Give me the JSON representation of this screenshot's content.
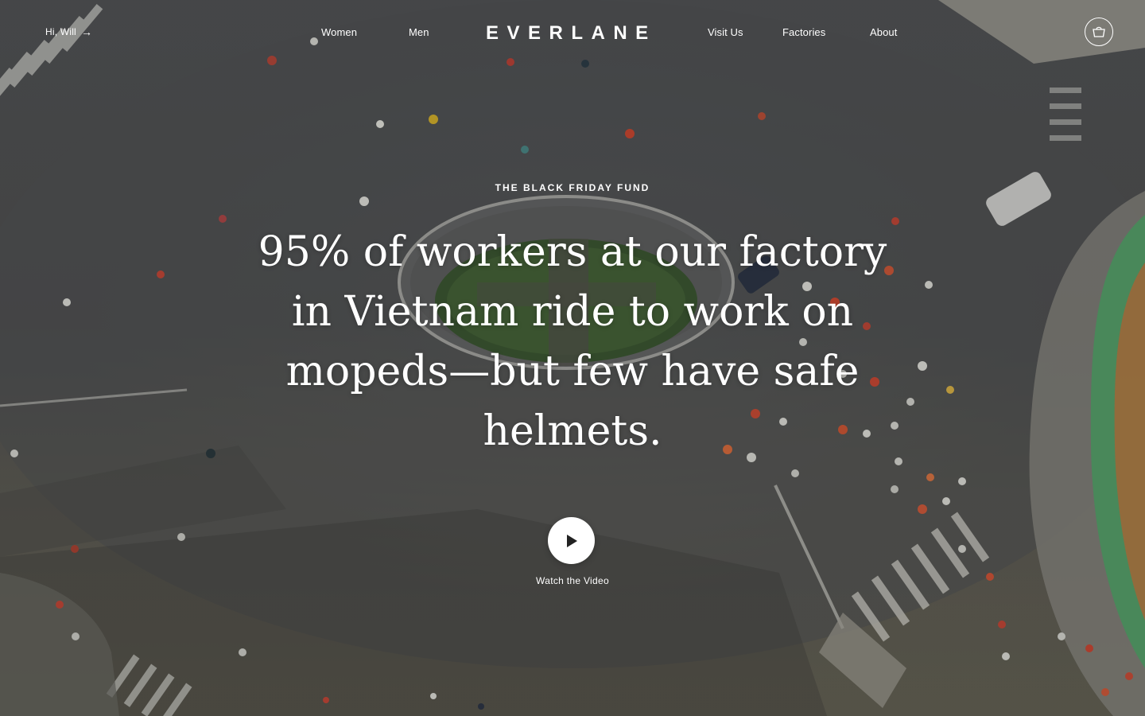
{
  "header": {
    "greeting": "Hi, Will",
    "greeting_arrow": "→",
    "logo": "EVERLANE",
    "nav_left": [
      "Women",
      "Men"
    ],
    "nav_right": [
      "Visit Us",
      "Factories",
      "About"
    ],
    "cart_icon": "cart-icon"
  },
  "hero": {
    "eyebrow": "THE BLACK FRIDAY FUND",
    "headline": "95% of workers at our factory in Vietnam ride to work on mopeds—but few have safe helmets.",
    "cta_label": "Watch the Video",
    "cta_icon": "play-icon"
  },
  "colors": {
    "text": "#ffffff",
    "road": "#5a5b5a",
    "planter": "#3e5a34",
    "awning_green": "#4bb36a"
  }
}
